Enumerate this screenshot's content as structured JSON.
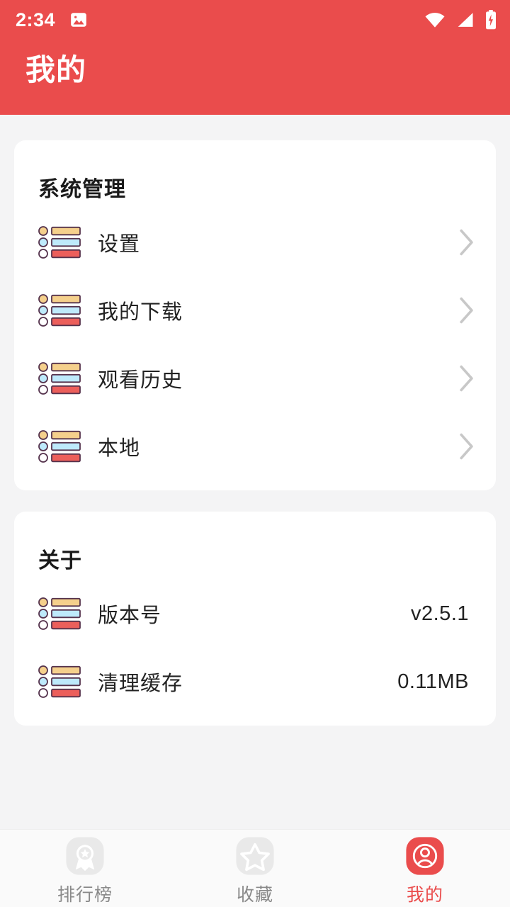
{
  "statusbar": {
    "time": "2:34",
    "icons": [
      "photo-icon",
      "wifi-icon",
      "signal-icon",
      "battery-charging-icon"
    ]
  },
  "header": {
    "title": "我的",
    "background_color": "#EA4C4C",
    "text_color": "#FFFFFF"
  },
  "theme": {
    "page_background": "#F4F4F5",
    "card_background": "#FFFFFF",
    "accent": "#EA4C4C",
    "tabbar_background": "#FAFAFA",
    "chevron_color": "#C8C8C8",
    "icon_outline": "#55334D",
    "icon_orange": "#F5D08C",
    "icon_blue": "#BEEAFB",
    "icon_red": "#EC5F5B"
  },
  "sections": [
    {
      "title": "系统管理",
      "rows": [
        {
          "icon": "list-icon",
          "label": "设置",
          "value": "",
          "chevron": true
        },
        {
          "icon": "list-icon",
          "label": "我的下载",
          "value": "",
          "chevron": true
        },
        {
          "icon": "list-icon",
          "label": "观看历史",
          "value": "",
          "chevron": true
        },
        {
          "icon": "list-icon",
          "label": "本地",
          "value": "",
          "chevron": true
        }
      ]
    },
    {
      "title": "关于",
      "rows": [
        {
          "icon": "list-icon",
          "label": "版本号",
          "value": "v2.5.1",
          "chevron": false
        },
        {
          "icon": "list-icon",
          "label": "清理缓存",
          "value": "0.11MB",
          "chevron": false
        }
      ]
    }
  ],
  "tabbar": {
    "tabs": [
      {
        "label": "排行榜",
        "icon": "medal-icon",
        "active": false
      },
      {
        "label": "收藏",
        "icon": "star-icon",
        "active": false
      },
      {
        "label": "我的",
        "icon": "person-icon",
        "active": true
      }
    ]
  }
}
